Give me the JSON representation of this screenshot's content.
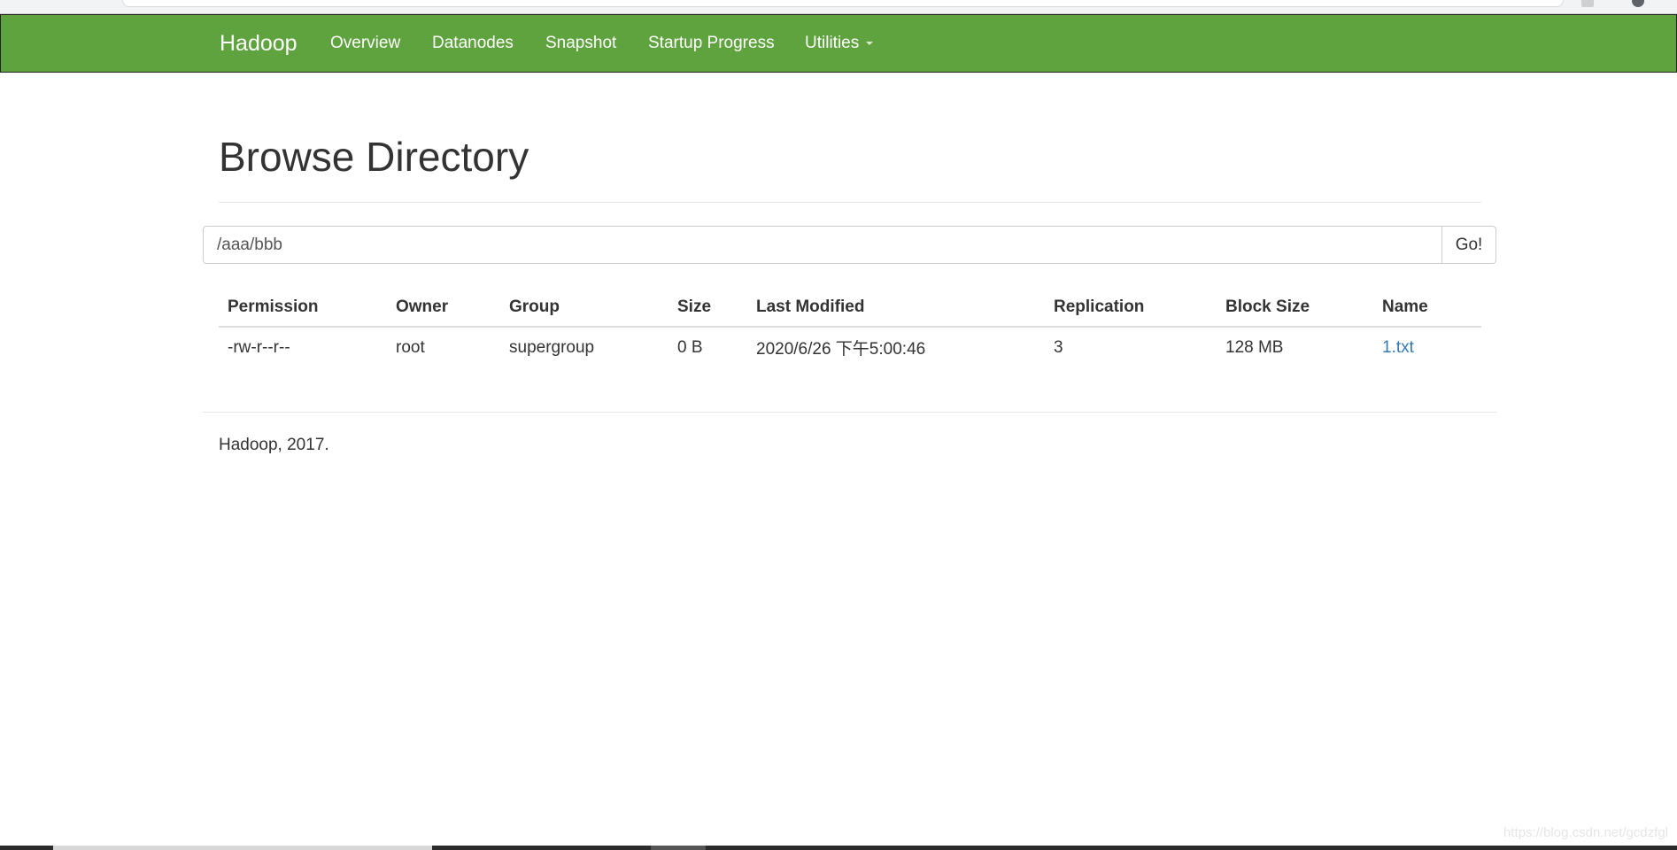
{
  "navbar": {
    "brand": "Hadoop",
    "items": [
      {
        "label": "Overview"
      },
      {
        "label": "Datanodes"
      },
      {
        "label": "Snapshot"
      },
      {
        "label": "Startup Progress"
      },
      {
        "label": "Utilities"
      }
    ],
    "color": "#5fa33e"
  },
  "page": {
    "title": "Browse Directory"
  },
  "path_bar": {
    "value": "/aaa/bbb",
    "button_label": "Go!"
  },
  "table": {
    "columns": [
      "Permission",
      "Owner",
      "Group",
      "Size",
      "Last Modified",
      "Replication",
      "Block Size",
      "Name"
    ],
    "rows": [
      {
        "permission": "-rw-r--r--",
        "owner": "root",
        "group": "supergroup",
        "size": "0 B",
        "last_modified": "2020/6/26 下午5:00:46",
        "replication": "3",
        "block_size": "128 MB",
        "name": "1.txt"
      }
    ]
  },
  "footer": {
    "text": "Hadoop, 2017."
  },
  "watermark": "https://blog.csdn.net/gcdzfgl",
  "colors": {
    "link": "#337ab7",
    "text": "#333333"
  }
}
